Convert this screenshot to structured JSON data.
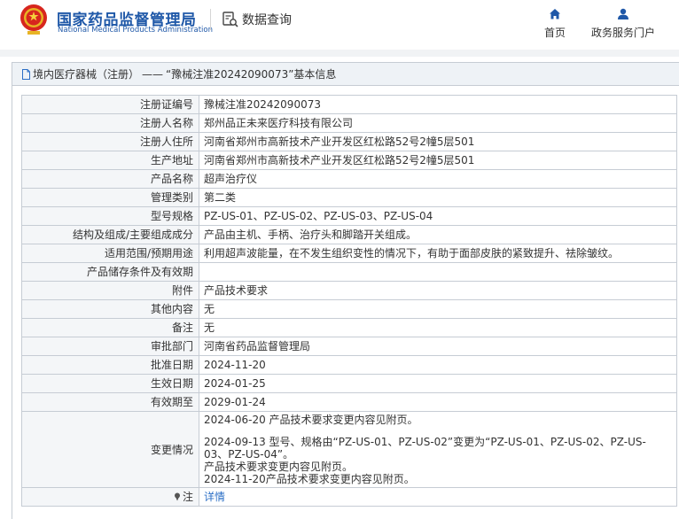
{
  "header": {
    "logo_cn": "国家药品监督管理局",
    "logo_en": "National Medical Products Administration",
    "query_label": "数据查询",
    "nav": [
      {
        "label": "首页",
        "icon": "home-icon"
      },
      {
        "label": "政务服务门户",
        "icon": "user-icon"
      }
    ]
  },
  "panel": {
    "category": "境内医疗器械（注册）",
    "dash": "——",
    "title_suffix": "“豫械注准20242090073”基本信息"
  },
  "rows": [
    {
      "label": "注册证编号",
      "value": "豫械注准20242090073"
    },
    {
      "label": "注册人名称",
      "value": "郑州品正未来医疗科技有限公司"
    },
    {
      "label": "注册人住所",
      "value": "河南省郑州市高新技术产业开发区红松路52号2幢5层501"
    },
    {
      "label": "生产地址",
      "value": "河南省郑州市高新技术产业开发区红松路52号2幢5层501"
    },
    {
      "label": "产品名称",
      "value": "超声治疗仪"
    },
    {
      "label": "管理类别",
      "value": "第二类"
    },
    {
      "label": "型号规格",
      "value": "PZ-US-01、PZ-US-02、PZ-US-03、PZ-US-04"
    },
    {
      "label": "结构及组成/主要组成成分",
      "value": "产品由主机、手柄、治疗头和脚踏开关组成。"
    },
    {
      "label": "适用范围/预期用途",
      "value": "利用超声波能量，在不发生组织变性的情况下，有助于面部皮肤的紧致提升、祛除皱纹。"
    },
    {
      "label": "产品储存条件及有效期",
      "value": ""
    },
    {
      "label": "附件",
      "value": "产品技术要求"
    },
    {
      "label": "其他内容",
      "value": "无"
    },
    {
      "label": "备注",
      "value": "无"
    },
    {
      "label": "审批部门",
      "value": "河南省药品监督管理局"
    },
    {
      "label": "批准日期",
      "value": "2024-11-20"
    },
    {
      "label": "生效日期",
      "value": "2024-01-25"
    },
    {
      "label": "有效期至",
      "value": "2029-01-24"
    }
  ],
  "changes": {
    "label": "变更情况",
    "line1": "2024-06-20 产品技术要求变更内容见附页。",
    "line2": "2024-09-13 型号、规格由“PZ-US-01、PZ-US-02”变更为“PZ-US-01、PZ-US-02、PZ-US-03、PZ-US-04”。",
    "line3": "产品技术要求变更内容见附页。",
    "line4": "2024-11-20产品技术要求变更内容见附页。"
  },
  "note": {
    "label": "注",
    "link": "详情"
  },
  "colors": {
    "brand_blue": "#1f58a8",
    "link_blue": "#2c6fc6",
    "label_bg": "#f4f6f8",
    "border": "#c6ccd4"
  }
}
